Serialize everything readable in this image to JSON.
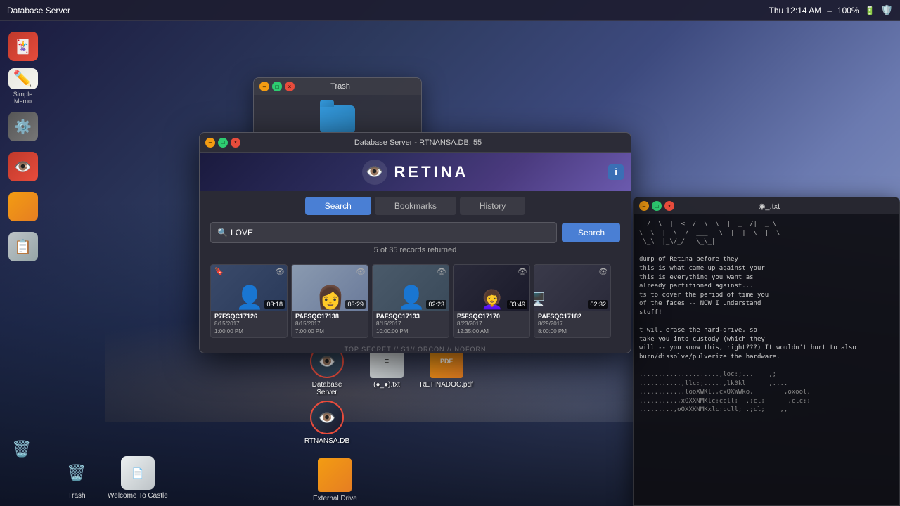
{
  "taskbar": {
    "title": "Database Server",
    "time": "Thu 12:14 AM",
    "battery": "100%"
  },
  "left_dock": {
    "items": [
      {
        "id": "cards",
        "label": "",
        "emoji": "🃏",
        "type": "cards"
      },
      {
        "id": "memo",
        "label": "Simple Memo",
        "emoji": "✏️",
        "type": "memo"
      },
      {
        "id": "gear",
        "label": "",
        "emoji": "⚙️",
        "type": "gear"
      },
      {
        "id": "eye",
        "label": "",
        "emoji": "👁️",
        "type": "eye"
      },
      {
        "id": "sticky",
        "label": "",
        "emoji": "🟨",
        "type": "sticky"
      },
      {
        "id": "notes",
        "label": "",
        "emoji": "📋",
        "type": "notes"
      }
    ]
  },
  "bottom_dock": {
    "items": [
      {
        "id": "trash",
        "label": "Trash",
        "emoji": "🗑️"
      },
      {
        "id": "welcome",
        "label": "Welcome To Castle",
        "emoji": "📄"
      },
      {
        "id": "drive",
        "label": "External Drive",
        "emoji": "💛"
      }
    ]
  },
  "trash_window": {
    "title": "Trash",
    "controls": {
      "minimize": "–",
      "maximize": "□",
      "close": "×"
    }
  },
  "db_window": {
    "title": "Database Server - RTNANSA.DB: 55",
    "controls": {
      "minimize": "–",
      "maximize": "□",
      "close": "×"
    },
    "retina": {
      "logo_text": "RETINA",
      "info_btn": "i"
    },
    "tabs": [
      {
        "id": "search",
        "label": "Search",
        "active": true
      },
      {
        "id": "bookmarks",
        "label": "Bookmarks",
        "active": false
      },
      {
        "id": "history",
        "label": "History",
        "active": false
      }
    ],
    "search": {
      "placeholder": "LOVE",
      "search_icon": "🔍",
      "btn_label": "Search",
      "records_info": "5 of 35 records returned"
    },
    "results": [
      {
        "id": "P7FSQC17126",
        "date": "8/15/2017",
        "time": "1:00:00 PM",
        "duration": "03:18",
        "thumb_type": "1",
        "has_bookmark": true
      },
      {
        "id": "PAFSQC17138",
        "date": "8/15/2017",
        "time": "7:00:00 PM",
        "duration": "03:29",
        "thumb_type": "2",
        "has_bookmark": false
      },
      {
        "id": "PAFSQC17133",
        "date": "8/15/2017",
        "time": "10:00:00 PM",
        "duration": "02:23",
        "thumb_type": "3",
        "has_bookmark": false
      },
      {
        "id": "P5FSQC17170",
        "date": "8/23/2017",
        "time": "12:35:00 AM",
        "duration": "03:49",
        "thumb_type": "4",
        "has_bookmark": false
      },
      {
        "id": "PAFSQC17182",
        "date": "8/29/2017",
        "time": "8:00:00 PM",
        "duration": "02:32",
        "thumb_type": "5",
        "has_bookmark": false
      }
    ],
    "watermark": "TOP SECRET // S1// ORCON // NOFORN",
    "secret_label": "TOP SECRET // S1// ORCON // NOFORN"
  },
  "terminal": {
    "title": "◉_.txt",
    "content": [
      "  / \\ | < / \\ \\ | _ /| __|",
      "\\ \\ | \\ / ___  \\ | | \\ | \\",
      " \\_\\ |_\\/_/   \\_\\_|",
      "",
      "dump of Retina before they",
      "this is what came up against your",
      "this is everything you want as",
      "already partitioned against...",
      "ts to cover the period of time you",
      "of the faces -- NOW I understand",
      "stuff!",
      "",
      "t will erase the hard-drive, so",
      "take you into custody (which they",
      "will -- you know this, right???) It wouldn't hurt to also",
      "burn/dissolve/pulverize the hardware.",
      "",
      ".....................,loc:;...    ,;",
      "...........,llc:;.....,lk0kl      ,....",
      "...........,looXWKl.,cxOXWWko,        ,oxool.",
      "..........,xOXXNMKlc:ccll;  .;cl;      .clc:;",
      ".........,oOXXKNMKxlc:ccll; .;cl;    ,;;"
    ]
  },
  "desktop_icons": [
    {
      "id": "db-server",
      "label": "Database Server",
      "type": "db-server",
      "symbol": "👁"
    },
    {
      "id": "txt-file",
      "label": "(●_●).txt",
      "type": "txt",
      "symbol": "≡"
    },
    {
      "id": "pdf-file",
      "label": "RETINADOC.pdf",
      "type": "pdf",
      "symbol": "PDF"
    },
    {
      "id": "retina-db",
      "label": "RTNANSA.DB",
      "type": "retina-db",
      "symbol": "👁"
    }
  ]
}
